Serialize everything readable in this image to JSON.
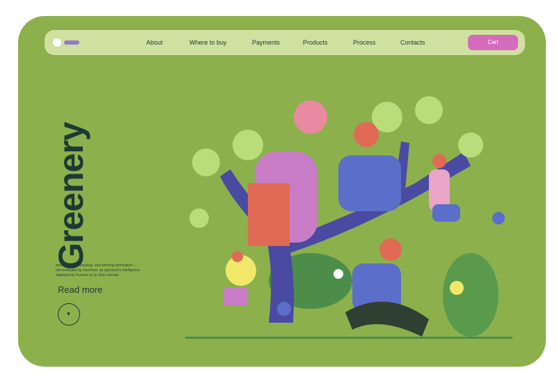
{
  "nav": {
    "links": [
      "About",
      "Where to buy",
      "Payments",
      "Products",
      "Process",
      "Contacts"
    ],
    "cart_label": "Cart"
  },
  "hero": {
    "title": "Greenery",
    "description": "perceiving, synthesizing, and inferring information—demonstrated by machines, as opposed to intelligence displayed by humans or by other animals",
    "read_more": "Read more"
  },
  "colors": {
    "background": "#8cb04c",
    "nav": "#cfe0a0",
    "accent": "#d46bbd",
    "text": "#1c3a35"
  }
}
